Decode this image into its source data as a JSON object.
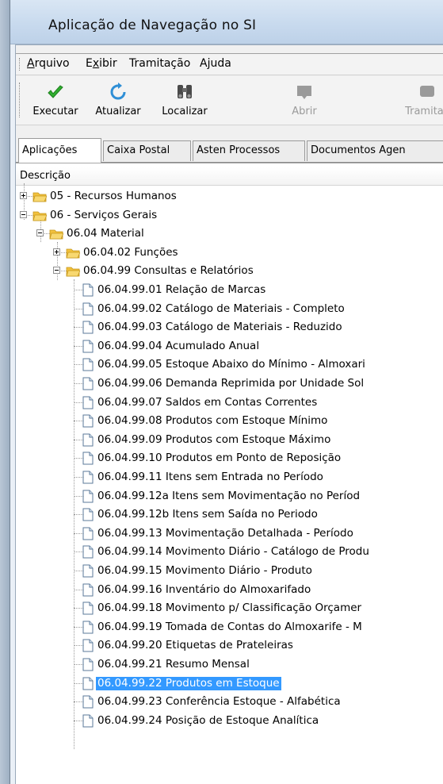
{
  "window": {
    "title": "Aplicação de Navegação no SI"
  },
  "menu": [
    {
      "pre": "",
      "u": "A",
      "post": "rquivo"
    },
    {
      "pre": "E",
      "u": "x",
      "post": "ibir"
    },
    {
      "pre": "Tramitação",
      "u": "",
      "post": ""
    },
    {
      "pre": "A",
      "u": "j",
      "post": "uda"
    }
  ],
  "toolbar": {
    "buttons": [
      {
        "label": "Executar",
        "icon": "checkmark-icon",
        "enabled": true
      },
      {
        "label": "Atualizar",
        "icon": "refresh-icon",
        "enabled": true
      },
      {
        "label": "Localizar",
        "icon": "binoculars-icon",
        "enabled": true
      },
      {
        "label": "Abrir",
        "icon": "open-icon",
        "enabled": false
      },
      {
        "label": "Tramitaç",
        "icon": "tramitacao-icon",
        "enabled": false
      }
    ]
  },
  "tabs": [
    "Aplicações",
    "Caixa Postal",
    "Asten Processos",
    "Documentos Agen"
  ],
  "tree": {
    "column_header": "Descrição",
    "nodes": [
      {
        "label": "05 - Recursos Humanos",
        "level": 0,
        "type": "folder",
        "expander": "plus"
      },
      {
        "label": "06 - Serviços Gerais",
        "level": 0,
        "type": "folder",
        "expander": "minus"
      },
      {
        "label": "06.04 Material",
        "level": 1,
        "type": "folder",
        "expander": "minus"
      },
      {
        "label": "06.04.02 Funções",
        "level": 2,
        "type": "folder",
        "expander": "plus"
      },
      {
        "label": "06.04.99 Consultas e Relatórios",
        "level": 2,
        "type": "folder",
        "expander": "minus"
      },
      {
        "label": "06.04.99.01 Relação de Marcas",
        "level": 3,
        "type": "doc"
      },
      {
        "label": "06.04.99.02 Catálogo de Materiais - Completo",
        "level": 3,
        "type": "doc"
      },
      {
        "label": "06.04.99.03 Catálogo de Materiais - Reduzido",
        "level": 3,
        "type": "doc"
      },
      {
        "label": "06.04.99.04 Acumulado Anual",
        "level": 3,
        "type": "doc"
      },
      {
        "label": "06.04.99.05 Estoque Abaixo do Mínimo - Almoxari",
        "level": 3,
        "type": "doc"
      },
      {
        "label": "06.04.99.06 Demanda Reprimida por Unidade Sol",
        "level": 3,
        "type": "doc"
      },
      {
        "label": "06.04.99.07 Saldos em Contas Correntes",
        "level": 3,
        "type": "doc"
      },
      {
        "label": "06.04.99.08 Produtos com Estoque Mínimo",
        "level": 3,
        "type": "doc"
      },
      {
        "label": "06.04.99.09 Produtos com Estoque Máximo",
        "level": 3,
        "type": "doc"
      },
      {
        "label": "06.04.99.10 Produtos em Ponto de Reposição",
        "level": 3,
        "type": "doc"
      },
      {
        "label": "06.04.99.11 Itens sem Entrada no Período",
        "level": 3,
        "type": "doc"
      },
      {
        "label": "06.04.99.12a Itens sem Movimentação no Períod",
        "level": 3,
        "type": "doc"
      },
      {
        "label": "06.04.99.12b Itens sem Saída no Periodo",
        "level": 3,
        "type": "doc"
      },
      {
        "label": "06.04.99.13 Movimentação Detalhada - Período",
        "level": 3,
        "type": "doc"
      },
      {
        "label": "06.04.99.14 Movimento Diário - Catálogo de Produ",
        "level": 3,
        "type": "doc"
      },
      {
        "label": "06.04.99.15 Movimento Diário - Produto",
        "level": 3,
        "type": "doc"
      },
      {
        "label": "06.04.99.16 Inventário do Almoxarifado",
        "level": 3,
        "type": "doc"
      },
      {
        "label": "06.04.99.18 Movimento p/ Classificação Orçamer",
        "level": 3,
        "type": "doc"
      },
      {
        "label": "06.04.99.19 Tomada de Contas do Almoxarife - M",
        "level": 3,
        "type": "doc"
      },
      {
        "label": "06.04.99.20 Etiquetas de Prateleiras",
        "level": 3,
        "type": "doc"
      },
      {
        "label": "06.04.99.21 Resumo Mensal",
        "level": 3,
        "type": "doc"
      },
      {
        "label": "06.04.99.22 Produtos em Estoque",
        "level": 3,
        "type": "doc",
        "selected": true
      },
      {
        "label": "06.04.99.23 Conferência Estoque - Alfabética",
        "level": 3,
        "type": "doc"
      },
      {
        "label": "06.04.99.24 Posição de Estoque Analítica",
        "level": 3,
        "type": "doc"
      }
    ]
  },
  "colors": {
    "selection": "#3399ff",
    "folder": "#f2c13d",
    "check": "#2fae2f",
    "refresh": "#2f8fd6"
  }
}
